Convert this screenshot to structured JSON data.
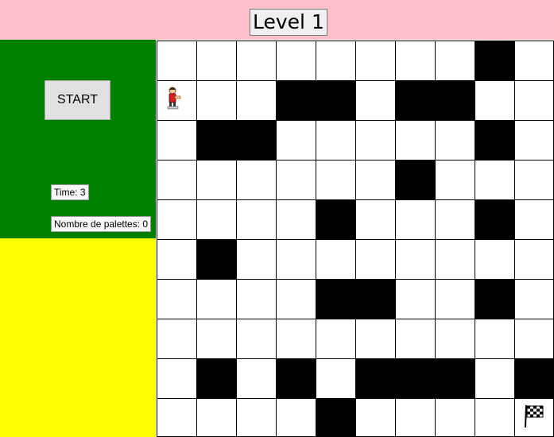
{
  "header": {
    "title": "Level 1",
    "background": "#ffc0cb"
  },
  "controls": {
    "start_label": "START",
    "time_label": "Time: 3",
    "palettes_label": "Nombre de palettes: 0",
    "background": "#008000"
  },
  "bottom_panel": {
    "background": "#ffff00"
  },
  "maze": {
    "rows": 10,
    "cols": 10,
    "legend": {
      "0": "floor",
      "1": "wall"
    },
    "grid": [
      [
        0,
        0,
        0,
        0,
        0,
        0,
        0,
        0,
        1,
        0
      ],
      [
        0,
        0,
        0,
        1,
        1,
        0,
        1,
        1,
        0,
        0
      ],
      [
        0,
        1,
        1,
        0,
        0,
        0,
        0,
        0,
        1,
        0
      ],
      [
        0,
        0,
        0,
        0,
        0,
        0,
        1,
        0,
        0,
        0
      ],
      [
        0,
        0,
        0,
        0,
        1,
        0,
        0,
        0,
        1,
        0
      ],
      [
        0,
        1,
        0,
        0,
        0,
        0,
        0,
        0,
        0,
        0
      ],
      [
        0,
        0,
        0,
        0,
        1,
        1,
        0,
        0,
        1,
        0
      ],
      [
        0,
        0,
        0,
        0,
        0,
        0,
        0,
        0,
        0,
        0
      ],
      [
        0,
        1,
        0,
        1,
        0,
        1,
        1,
        1,
        0,
        1
      ],
      [
        0,
        0,
        0,
        0,
        1,
        0,
        0,
        0,
        0,
        0
      ]
    ],
    "player": {
      "row": 1,
      "col": 0,
      "icon": "player-icon"
    },
    "goal": {
      "row": 9,
      "col": 9,
      "icon": "checkered-flag-icon"
    },
    "colors": {
      "wall": "#000000",
      "floor": "#ffffff",
      "player": "#d62020"
    }
  }
}
